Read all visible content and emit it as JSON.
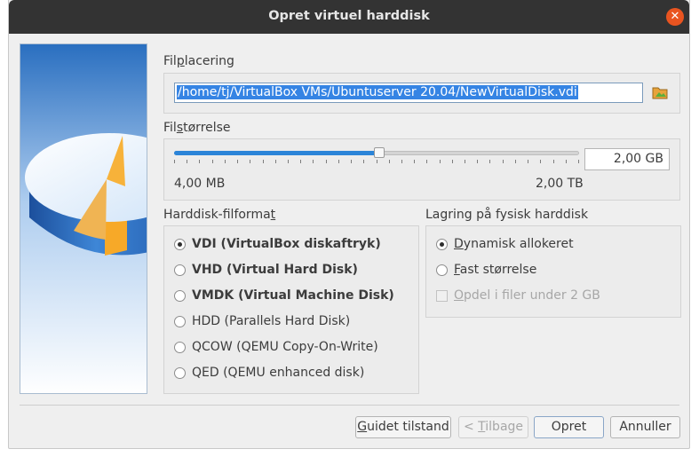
{
  "window": {
    "title": "Opret virtuel harddisk",
    "close_icon": "close-icon",
    "close_glyph": "✕"
  },
  "location": {
    "label_pre": "Fil",
    "label_mnemonic": "p",
    "label_post": "lacering",
    "path_value": "/home/tj/VirtualBox VMs/Ubuntuserver 20.04/NewVirtualDisk.vdi",
    "folder_icon": "folder-icon"
  },
  "size": {
    "label_pre": "Fil",
    "label_mnemonic": "s",
    "label_post": "tørrelse",
    "value": "2,00 GB",
    "min_label": "4,00 MB",
    "max_label": "2,00 TB",
    "slider_fraction": 0.506
  },
  "format": {
    "label_pre": "Harddisk-filforma",
    "label_mnemonic": "t",
    "label_post": "",
    "options": [
      {
        "label": "VDI (VirtualBox diskaftryk)",
        "checked": true,
        "bold": true
      },
      {
        "label": "VHD (Virtual Hard Disk)",
        "checked": false,
        "bold": true
      },
      {
        "label": "VMDK (Virtual Machine Disk)",
        "checked": false,
        "bold": true
      },
      {
        "label": "HDD (Parallels Hard Disk)",
        "checked": false,
        "bold": false
      },
      {
        "label": "QCOW (QEMU Copy-On-Write)",
        "checked": false,
        "bold": false
      },
      {
        "label": "QED (QEMU enhanced disk)",
        "checked": false,
        "bold": false
      }
    ]
  },
  "storage": {
    "label": "Lagring på fysisk harddisk",
    "dynamic_mnemonic": "D",
    "dynamic_rest": "ynamisk allokeret",
    "fixed_mnemonic": "F",
    "fixed_rest": "ast størrelse",
    "split_mnemonic": "O",
    "split_rest": "pdel i filer under 2 GB"
  },
  "buttons": {
    "guided_mnemonic": "G",
    "guided_rest": "uidet tilstand",
    "back_pre": "< ",
    "back_mnemonic": "T",
    "back_rest": "ilbage",
    "create": "Opret",
    "cancel": "Annuller"
  },
  "colors": {
    "titlebar": "#333333",
    "close": "#e95420",
    "accent": "#2b84d8",
    "selection": "#3584e4"
  }
}
